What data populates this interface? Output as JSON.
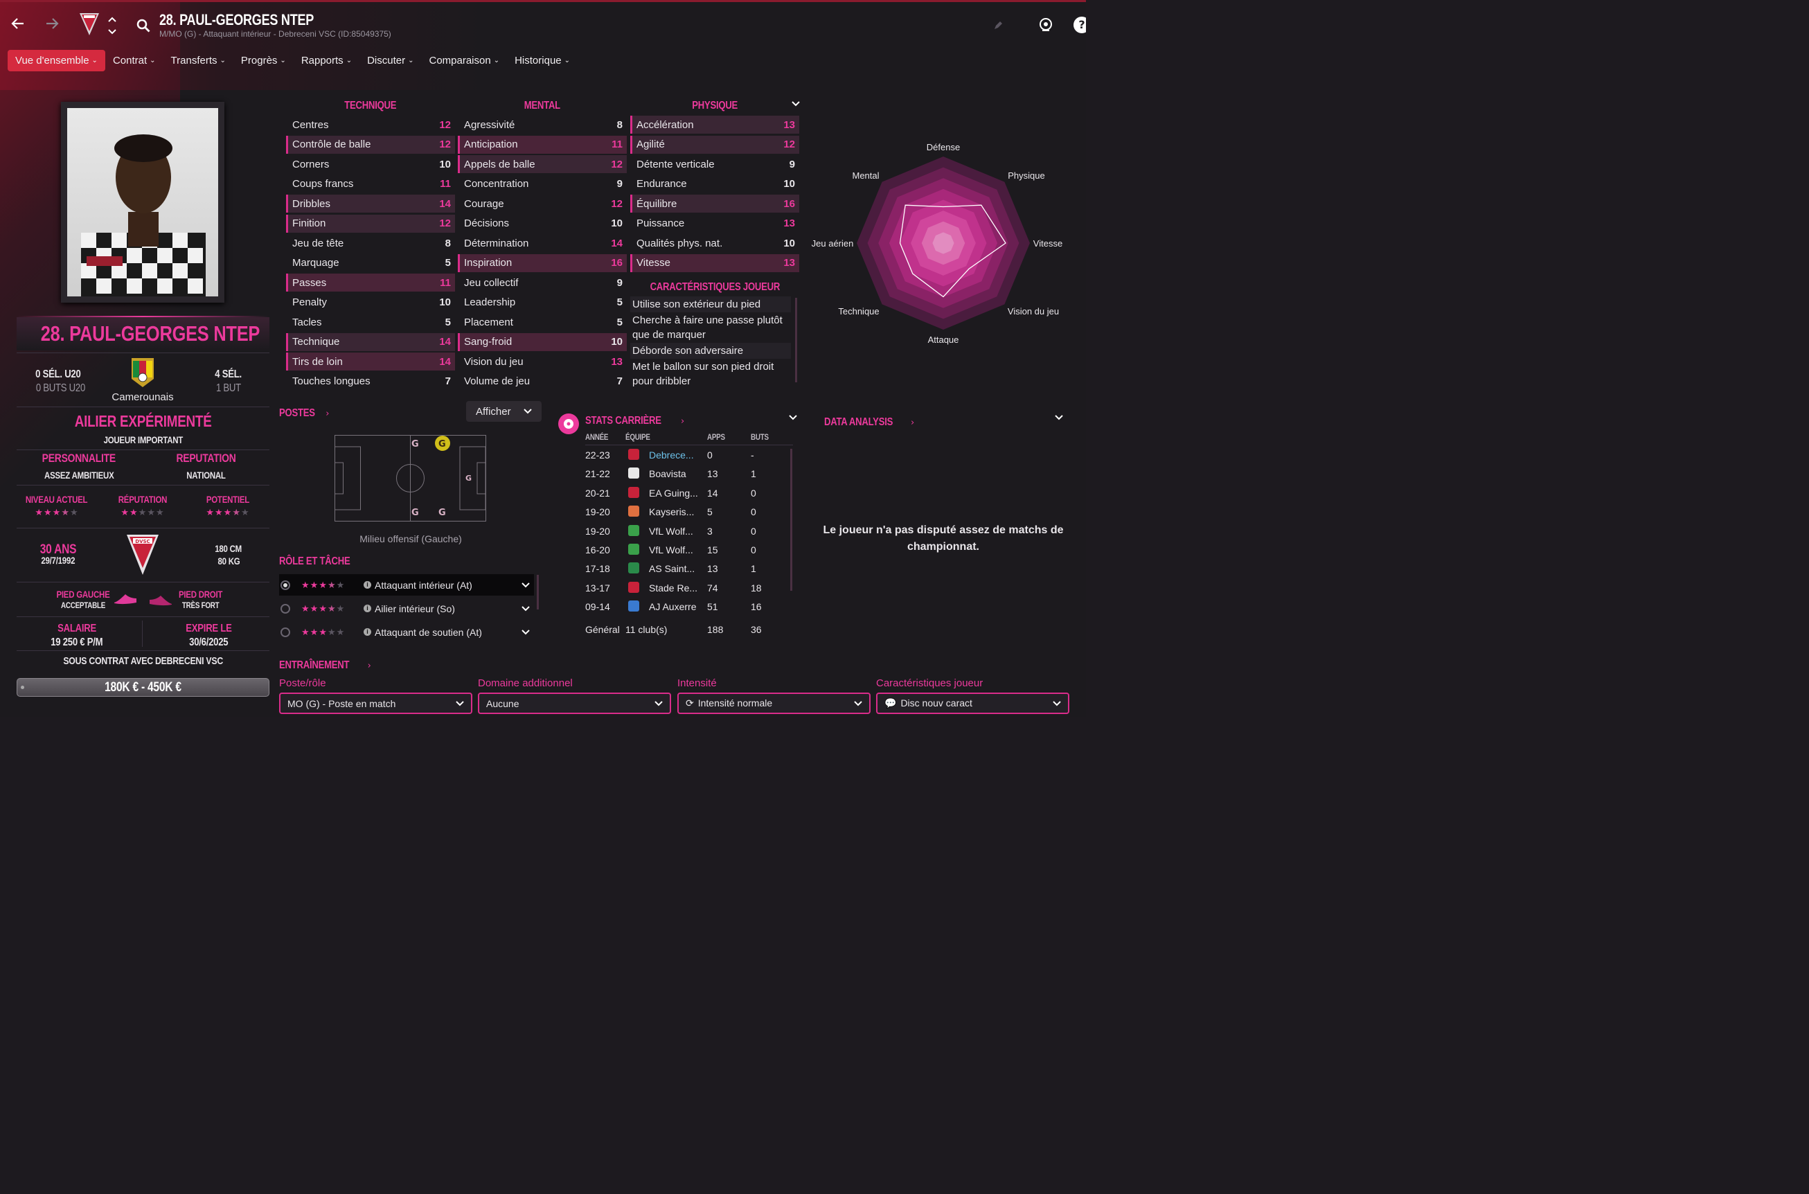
{
  "header": {
    "player_title": "28. PAUL-GEORGES NTEP",
    "subtitle": "M/MO (G) - Attaquant intérieur - Debreceni VSC (ID:85049375)"
  },
  "tabs": [
    {
      "label": "Vue d'ensemble",
      "active": true
    },
    {
      "label": "Contrat"
    },
    {
      "label": "Transferts"
    },
    {
      "label": "Progrès"
    },
    {
      "label": "Rapports"
    },
    {
      "label": "Discuter"
    },
    {
      "label": "Comparaison"
    },
    {
      "label": "Historique"
    }
  ],
  "profile": {
    "name": "28. PAUL-GEORGES NTEP",
    "u20_caps": "0 SÉL. U20",
    "u20_goals": "0 BUTS U20",
    "caps": "4 SÉL.",
    "goals": "1 BUT",
    "nationality": "Camerounais",
    "role_title": "AILIER EXPÉRIMENTÉ",
    "status": "JOUEUR IMPORTANT",
    "personality_label": "PERSONNALITE",
    "personality": "ASSEZ AMBITIEUX",
    "reputation_label": "REPUTATION",
    "reputation": "NATIONAL",
    "current_label": "NIVEAU ACTUEL",
    "rep_label": "RÉPUTATION",
    "potential_label": "POTENTIEL",
    "current_stars": 3.5,
    "rep_stars": 2,
    "potential_stars": 3.5,
    "age": "30 ANS",
    "dob": "29/7/1992",
    "height": "180 CM",
    "weight": "80 KG",
    "left_foot_label": "PIED GAUCHE",
    "left_foot": "ACCEPTABLE",
    "right_foot_label": "PIED DROIT",
    "right_foot": "TRÈS FORT",
    "salary_label": "SALAIRE",
    "salary": "19 250 € P/M",
    "expires_label": "EXPIRE LE",
    "expires": "30/6/2025",
    "contract": "SOUS CONTRAT AVEC DEBRECENI VSC",
    "value": "180K € - 450K €",
    "club_logo_text": "DVSC"
  },
  "attributes": {
    "technique_label": "TECHNIQUE",
    "mental_label": "MENTAL",
    "physique_label": "PHYSIQUE",
    "technique": [
      {
        "name": "Centres",
        "value": "12",
        "hl": 0,
        "pink": true
      },
      {
        "name": "Contrôle de balle",
        "value": "12",
        "hl": 1,
        "pink": true
      },
      {
        "name": "Corners",
        "value": "10",
        "hl": 0,
        "pink": false
      },
      {
        "name": "Coups francs",
        "value": "11",
        "hl": 0,
        "pink": true
      },
      {
        "name": "Dribbles",
        "value": "14",
        "hl": 1,
        "pink": true
      },
      {
        "name": "Finition",
        "value": "12",
        "hl": 1,
        "pink": true
      },
      {
        "name": "Jeu de tête",
        "value": "8",
        "hl": 0,
        "pink": false
      },
      {
        "name": "Marquage",
        "value": "5",
        "hl": 0,
        "pink": false
      },
      {
        "name": "Passes",
        "value": "11",
        "hl": 2,
        "pink": true
      },
      {
        "name": "Penalty",
        "value": "10",
        "hl": 0,
        "pink": false
      },
      {
        "name": "Tacles",
        "value": "5",
        "hl": 0,
        "pink": false
      },
      {
        "name": "Technique",
        "value": "14",
        "hl": 1,
        "pink": true
      },
      {
        "name": "Tirs de loin",
        "value": "14",
        "hl": 2,
        "pink": true
      },
      {
        "name": "Touches longues",
        "value": "7",
        "hl": 0,
        "pink": false
      }
    ],
    "mental": [
      {
        "name": "Agressivité",
        "value": "8",
        "hl": 0,
        "pink": false
      },
      {
        "name": "Anticipation",
        "value": "11",
        "hl": 2,
        "pink": true
      },
      {
        "name": "Appels de balle",
        "value": "12",
        "hl": 1,
        "pink": true
      },
      {
        "name": "Concentration",
        "value": "9",
        "hl": 0,
        "pink": false
      },
      {
        "name": "Courage",
        "value": "12",
        "hl": 0,
        "pink": true
      },
      {
        "name": "Décisions",
        "value": "10",
        "hl": 0,
        "pink": false
      },
      {
        "name": "Détermination",
        "value": "14",
        "hl": 0,
        "pink": true
      },
      {
        "name": "Inspiration",
        "value": "16",
        "hl": 2,
        "pink": true
      },
      {
        "name": "Jeu collectif",
        "value": "9",
        "hl": 0,
        "pink": false
      },
      {
        "name": "Leadership",
        "value": "5",
        "hl": 0,
        "pink": false
      },
      {
        "name": "Placement",
        "value": "5",
        "hl": 0,
        "pink": false
      },
      {
        "name": "Sang-froid",
        "value": "10",
        "hl": 2,
        "pink": false
      },
      {
        "name": "Vision du jeu",
        "value": "13",
        "hl": 0,
        "pink": true
      },
      {
        "name": "Volume de jeu",
        "value": "7",
        "hl": 0,
        "pink": false
      }
    ],
    "physique": [
      {
        "name": "Accélération",
        "value": "13",
        "hl": 1,
        "pink": true
      },
      {
        "name": "Agilité",
        "value": "12",
        "hl": 1,
        "pink": true
      },
      {
        "name": "Détente verticale",
        "value": "9",
        "hl": 0,
        "pink": false
      },
      {
        "name": "Endurance",
        "value": "10",
        "hl": 0,
        "pink": false
      },
      {
        "name": "Équilibre",
        "value": "16",
        "hl": 1,
        "pink": true
      },
      {
        "name": "Puissance",
        "value": "13",
        "hl": 0,
        "pink": true
      },
      {
        "name": "Qualités phys. nat.",
        "value": "10",
        "hl": 0,
        "pink": false
      },
      {
        "name": "Vitesse",
        "value": "13",
        "hl": 2,
        "pink": true
      }
    ]
  },
  "traits": {
    "title": "CARACTÉRISTIQUES JOUEUR",
    "items": [
      "Utilise son extérieur du pied",
      "Cherche à faire une passe plutôt que de marquer",
      "Déborde son adversaire",
      "Met le ballon sur son pied droit pour dribbler"
    ]
  },
  "radar": {
    "labels": [
      "Défense",
      "Physique",
      "Vitesse",
      "Vision du jeu",
      "Attaque",
      "Technique",
      "Jeu aérien",
      "Mental"
    ],
    "values": [
      0.42,
      0.62,
      0.72,
      0.42,
      0.62,
      0.5,
      0.5,
      0.62
    ]
  },
  "positions": {
    "title": "POSTES",
    "show_button": "Afficher",
    "caption": "Milieu offensif (Gauche)"
  },
  "roles": {
    "title": "RÔLE ET TÂCHE",
    "items": [
      {
        "label": "Attaquant intérieur (At)",
        "stars": 3.5,
        "selected": true
      },
      {
        "label": "Ailier intérieur (So)",
        "stars": 3.5,
        "selected": false
      },
      {
        "label": "Attaquant de soutien (At)",
        "stars": 3,
        "selected": false
      }
    ]
  },
  "career": {
    "title": "STATS CARRIÈRE",
    "col_year": "ANNÉE",
    "col_team": "ÉQUIPE",
    "col_apps": "APPS",
    "col_goals": "BUTS",
    "rows": [
      {
        "year": "22-23",
        "team": "Debrece...",
        "apps": "0",
        "goals": "-",
        "link": true
      },
      {
        "year": "21-22",
        "team": "Boavista",
        "apps": "13",
        "goals": "1"
      },
      {
        "year": "20-21",
        "team": "EA Guing...",
        "apps": "14",
        "goals": "0"
      },
      {
        "year": "19-20",
        "team": "Kayseris...",
        "apps": "5",
        "goals": "0"
      },
      {
        "year": "19-20",
        "team": "VfL Wolf...",
        "apps": "3",
        "goals": "0"
      },
      {
        "year": "16-20",
        "team": "VfL Wolf...",
        "apps": "15",
        "goals": "0"
      },
      {
        "year": "17-18",
        "team": "AS Saint...",
        "apps": "13",
        "goals": "1"
      },
      {
        "year": "13-17",
        "team": "Stade Re...",
        "apps": "74",
        "goals": "18"
      },
      {
        "year": "09-14",
        "team": "AJ Auxerre",
        "apps": "51",
        "goals": "16"
      }
    ],
    "total_label": "Général",
    "total_clubs": "11 club(s)",
    "total_apps": "188",
    "total_goals": "36"
  },
  "analysis": {
    "title": "DATA ANALYSIS",
    "message": "Le joueur n'a pas disputé assez de matchs de championnat."
  },
  "training": {
    "title": "ENTRAÎNEMENT",
    "pos_label": "Poste/rôle",
    "pos_value": "MO (G) - Poste en match",
    "extra_label": "Domaine additionnel",
    "extra_value": "Aucune",
    "intensity_label": "Intensité",
    "intensity_value": "Intensité normale",
    "traits_label": "Caractéristiques joueur",
    "traits_value": "Disc nouv caract"
  },
  "colors": {
    "accent": "#ec3a9c",
    "active_tab": "#d52a3f",
    "background": "#1c1a1e"
  }
}
